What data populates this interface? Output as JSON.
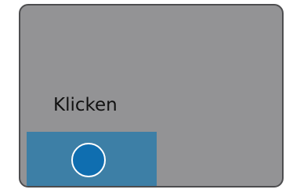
{
  "panel": {
    "label": "Klicken"
  },
  "colors": {
    "panel_bg": "#939395",
    "panel_border": "#4d4d4f",
    "button_area": "#3d7fa6",
    "circle_fill": "#0f6eb0",
    "circle_outline": "#ffffff"
  },
  "icons": {
    "click_target": "circle-button-icon"
  }
}
